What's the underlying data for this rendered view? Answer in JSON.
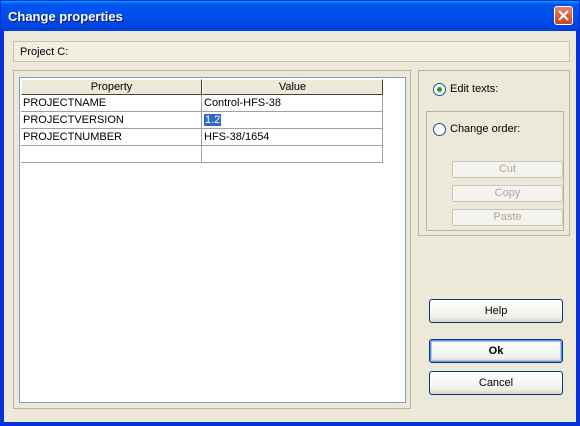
{
  "window": {
    "title": "Change properties"
  },
  "project_label": "Project C:",
  "grid": {
    "columns": [
      "Property",
      "Value"
    ],
    "rows": [
      {
        "property": "PROJECTNAME",
        "value": "Control-HFS-38"
      },
      {
        "property": "PROJECTVERSION",
        "value": "1.2"
      },
      {
        "property": "PROJECTNUMBER",
        "value": "HFS-38/1654"
      },
      {
        "property": "",
        "value": ""
      }
    ]
  },
  "mode": {
    "edit_texts": "Edit texts:",
    "change_order": "Change order:",
    "selected": "edit_texts"
  },
  "order_buttons": {
    "cut": "Cut",
    "copy": "Copy",
    "paste": "Paste"
  },
  "buttons": {
    "help": "Help",
    "ok": "Ok",
    "cancel": "Cancel"
  },
  "colors": {
    "titlebar": "#0054e3",
    "selection": "#316ac5",
    "dialog_bg": "#ece9d8"
  },
  "icons": {
    "close": "close-icon"
  }
}
